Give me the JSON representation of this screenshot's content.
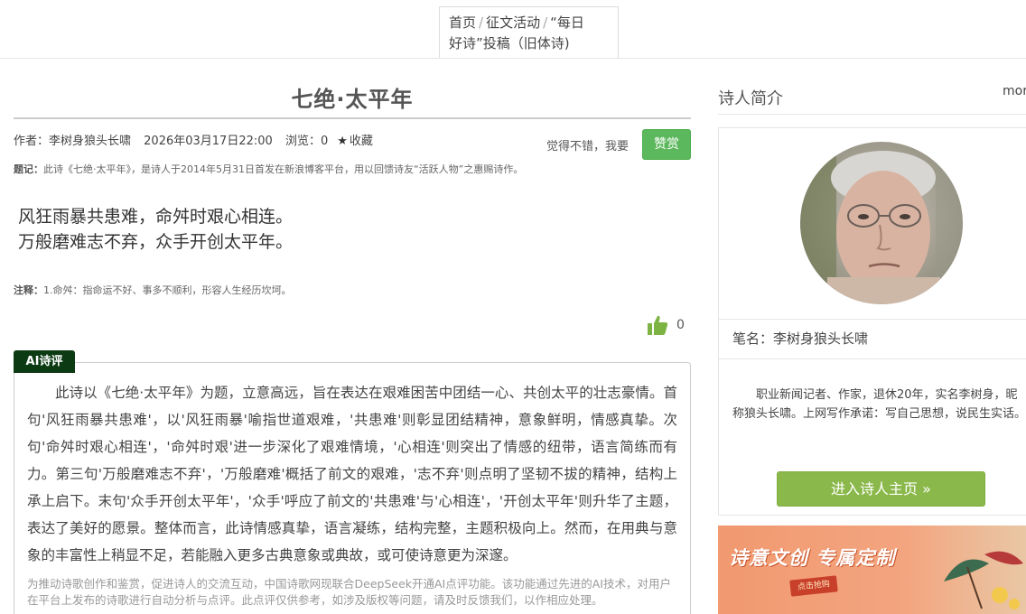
{
  "breadcrumb": {
    "home": "首页",
    "separator": "/",
    "activity": "征文活动",
    "current_line1": "“每日",
    "current_line2": "好诗”投稿（旧体诗)"
  },
  "poem": {
    "title": "七绝·太平年",
    "author": "作者：李树身狼头长啸",
    "date": "2026年03月17日22:00",
    "views": "浏览：0",
    "favorite_label": "收藏",
    "like_prompt": "觉得不错，我要",
    "reward_label": "赞赏",
    "inscription_label": "题记：",
    "inscription_text": "此诗《七绝·太平年》，是诗人于2014年5月31日首发在新浪博客平台，用以回馈诗友“活跃人物”之惠赐诗作。",
    "verses": [
      "风狂雨暴共患难，命舛时艰心相连。",
      "万般磨难志不弃，众手开创太平年。"
    ],
    "annotation_label": "注释：",
    "annotation_text": "1.命舛：指命运不好、事多不顺利，形容人生经历坎坷。",
    "like_count": "0"
  },
  "ai_review": {
    "tag": "AI诗评",
    "text": "此诗以《七绝·太平年》为题，立意高远，旨在表达在艰难困苦中团结一心、共创太平的壮志豪情。首句'风狂雨暴共患难'，以'风狂雨暴'喻指世道艰难，'共患难'则彰显团结精神，意象鲜明，情感真挚。次句'命舛时艰心相连'，'命舛时艰'进一步深化了艰难情境，'心相连'则突出了情感的纽带，语言简练而有力。第三句'万般磨难志不弃'，'万般磨难'概括了前文的艰难，'志不弃'则点明了坚韧不拔的精神，结构上承上启下。末句'众手开创太平年'，'众手'呼应了前文的'共患难'与'心相连'，'开创太平年'则升华了主题，表达了美好的愿景。整体而言，此诗情感真挚，语言凝练，结构完整，主题积极向上。然而，在用典与意象的丰富性上稍显不足，若能融入更多古典意象或典故，或可使诗意更为深邃。",
    "disclaimer": "为推动诗歌创作和鉴赏，促进诗人的交流互动，中国诗歌网现联合DeepSeek开通AI点评功能。该功能通过先进的AI技术，对用户在平台上发布的诗歌进行自动分析与点评。此点评仅供参考，如涉及版权等问题，请及时反馈我们，以作相应处理。"
  },
  "sidebar": {
    "heading": "诗人简介",
    "more": "more",
    "pen_name": "笔名：李树身狼头长啸",
    "bio": "职业新闻记者、作家，退休20年，实名李树身，昵称狼头长啸。上网写作承诺：写自己思想，说民生实话。",
    "home_button": "进入诗人主页 »",
    "banner_title": "诗意文创  专属定制",
    "banner_sub": "点击抢购"
  },
  "colors": {
    "reward_green": "#5cb85c",
    "home_green": "#8ab84a",
    "ai_tag_bg": "#0b3a13",
    "thumb_green": "#7cb342",
    "banner_orange": "#f19970"
  },
  "icons": {
    "favorite": "star-icon",
    "like": "thumbs-up-icon",
    "home_arrow": "double-chevron-right-icon"
  }
}
